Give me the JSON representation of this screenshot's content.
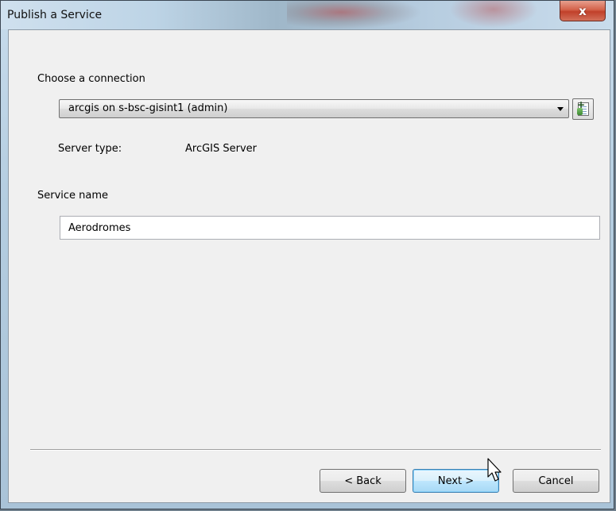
{
  "window": {
    "title": "Publish a Service",
    "close_glyph": "x"
  },
  "connection": {
    "label": "Choose a connection",
    "selected": "arcgis on s-bsc-gisint1 (admin)",
    "add_button_icon": "add-server-connection-icon"
  },
  "server": {
    "type_label": "Server type:",
    "type_value": "ArcGIS Server"
  },
  "service": {
    "name_label": "Service name",
    "name_value": "Aerodromes"
  },
  "buttons": {
    "back": "< Back",
    "next": "Next >",
    "cancel": "Cancel"
  },
  "colors": {
    "close_button": "#c1402a",
    "default_button_border": "#3c7fb1"
  }
}
